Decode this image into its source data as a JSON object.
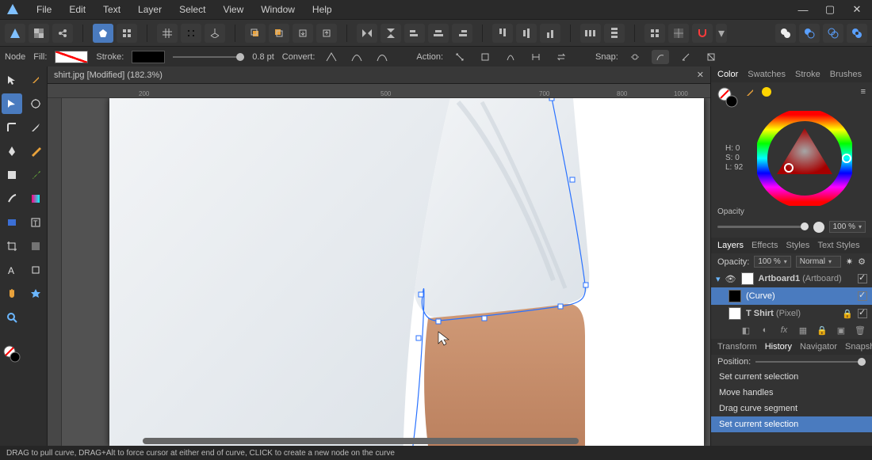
{
  "titlebar": {
    "menus": [
      "File",
      "Edit",
      "Text",
      "Layer",
      "Select",
      "View",
      "Window",
      "Help"
    ]
  },
  "doc": {
    "tab_label": "shirt.jpg [Modified] (182.3%)"
  },
  "context": {
    "node_label": "Node",
    "fill_label": "Fill:",
    "stroke_label": "Stroke:",
    "stroke_width": "0.8 pt",
    "convert_label": "Convert:",
    "action_label": "Action:",
    "snap_label": "Snap:"
  },
  "ruler_ticks": [
    "200",
    "500",
    "700",
    "800",
    "1000"
  ],
  "panels": {
    "color_tabs": [
      "Color",
      "Swatches",
      "Stroke",
      "Brushes"
    ],
    "hsl": {
      "h": "H: 0",
      "s": "S: 0",
      "l": "L: 92"
    },
    "opacity_label": "Opacity",
    "opacity_value": "100 %",
    "layer_tabs": [
      "Layers",
      "Effects",
      "Styles",
      "Text Styles"
    ],
    "layer_opacity_label": "Opacity:",
    "layer_opacity_value": "100 %",
    "layer_blend": "Normal",
    "layers": [
      {
        "name": "Artboard1",
        "suffix": " (Artboard)"
      },
      {
        "name": "(Curve)",
        "suffix": ""
      },
      {
        "name": "T Shirt",
        "suffix": " (Pixel)"
      }
    ],
    "history_tabs": [
      "Transform",
      "History",
      "Navigator",
      "Snapshots"
    ],
    "position_label": "Position:",
    "history_items": [
      "Set current selection",
      "Move handles",
      "Drag curve segment",
      "Set current selection"
    ]
  },
  "status": {
    "text": "DRAG to pull curve, DRAG+Alt to force cursor at either end of curve, CLICK to create a new node on the curve"
  }
}
